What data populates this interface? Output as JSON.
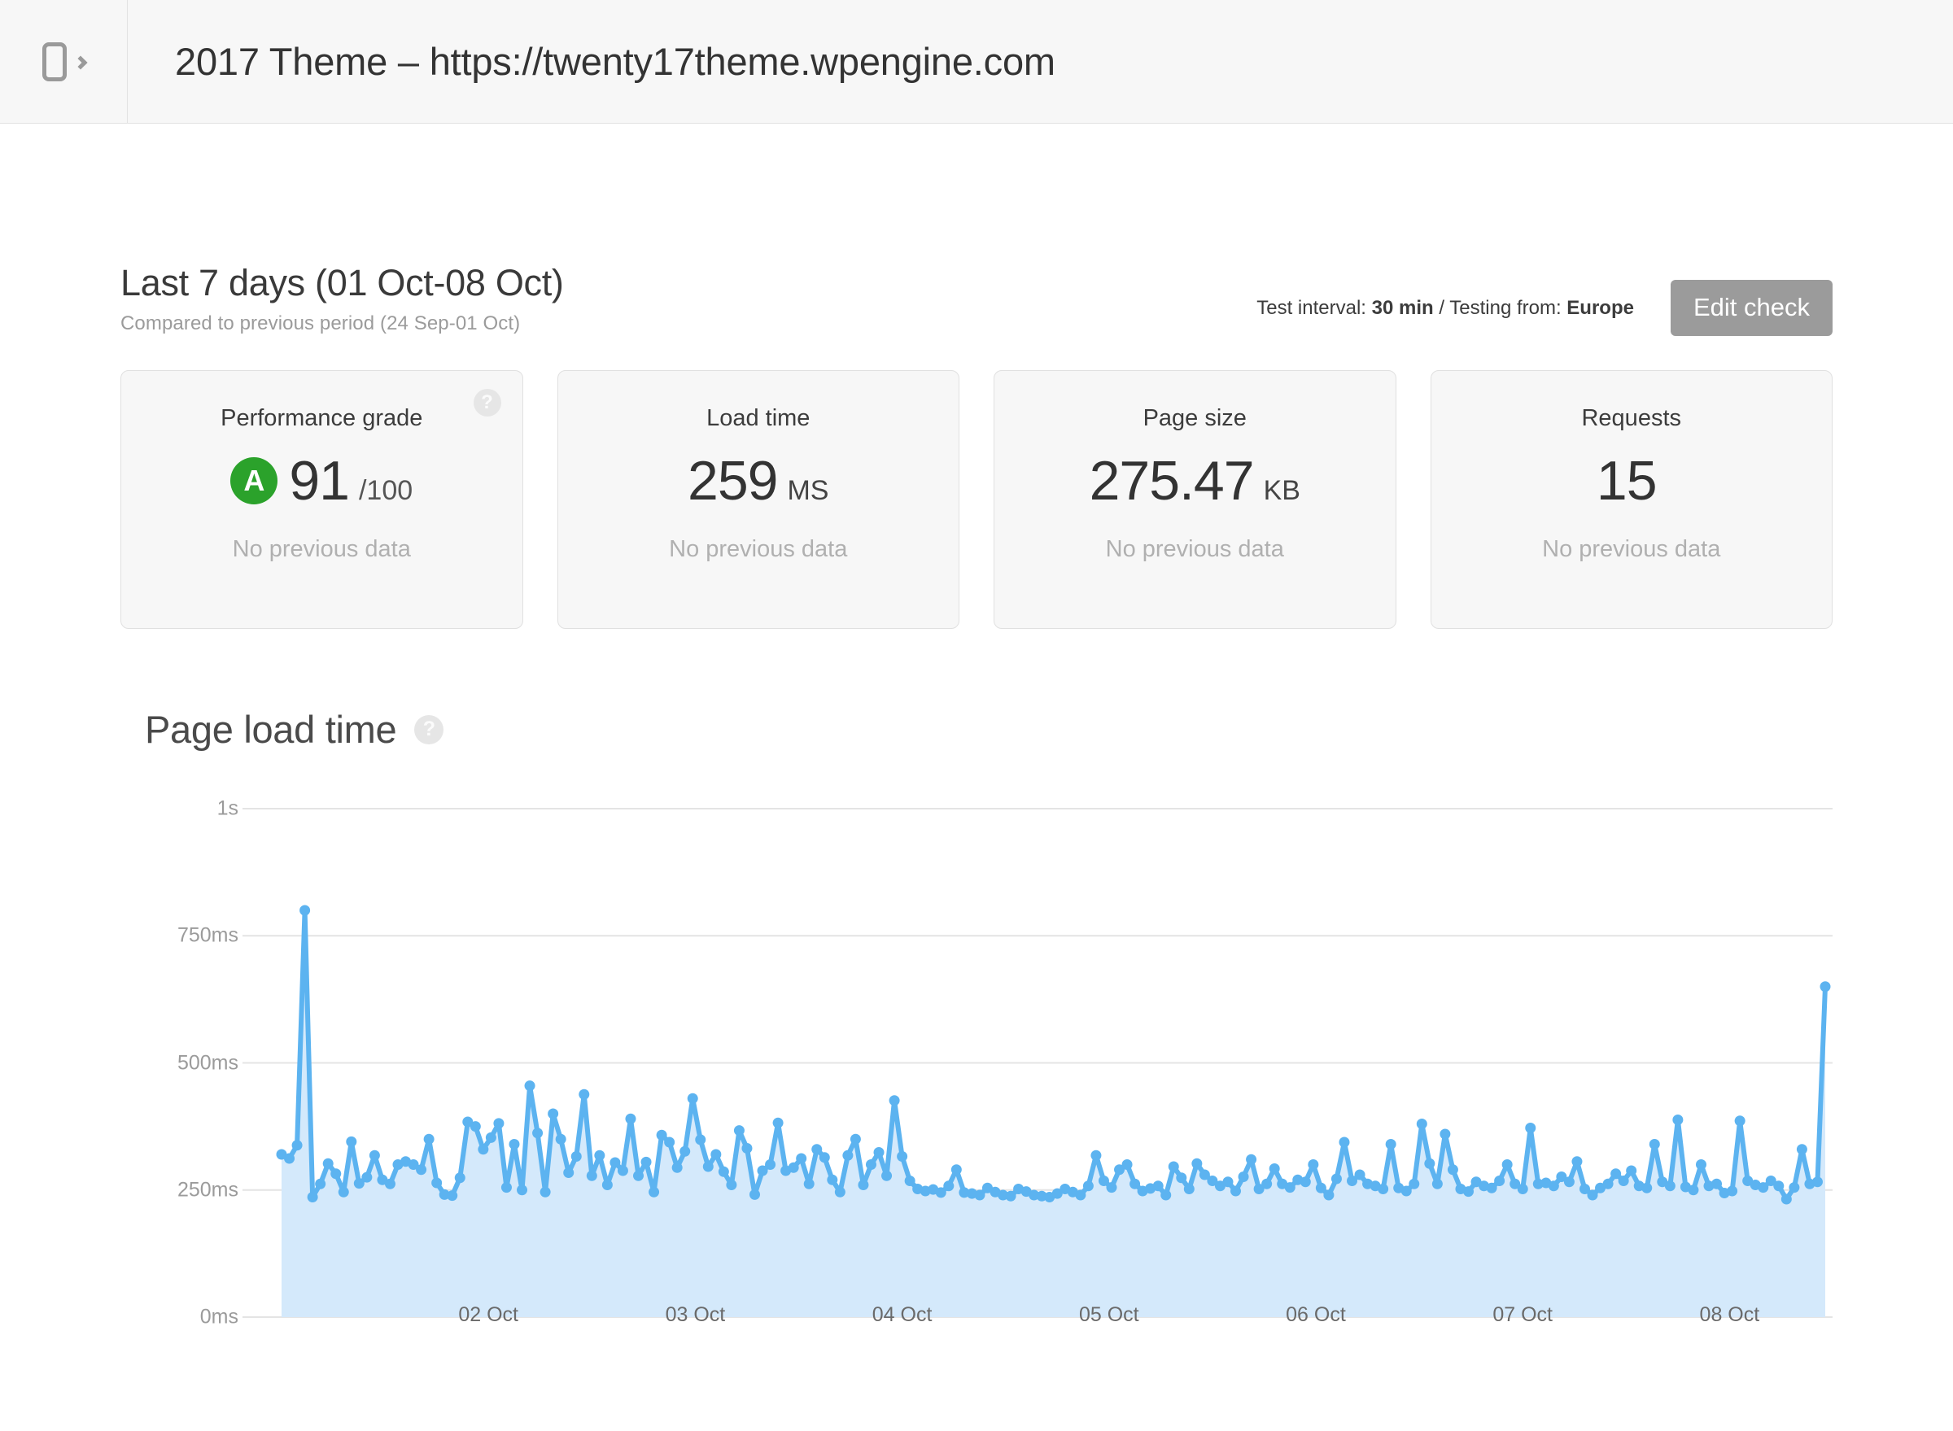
{
  "topbar": {
    "device_icon": "mobile-device-icon",
    "chevron_icon": "chevron-right-icon",
    "title": "2017 Theme – https://twenty17theme.wpengine.com"
  },
  "header": {
    "period_title": "Last 7 days (01 Oct-08 Oct)",
    "period_subtitle": "Compared to previous period (24 Sep-01 Oct)",
    "meta_interval_label": "Test interval: ",
    "meta_interval_value": "30 min",
    "meta_separator": " / ",
    "meta_location_label": "Testing from: ",
    "meta_location_value": "Europe",
    "edit_check_label": "Edit check"
  },
  "cards": [
    {
      "title": "Performance grade",
      "grade": "A",
      "value": "91",
      "unit": "/100",
      "note": "No previous data",
      "has_help": true,
      "grade_color": "#2ba22b"
    },
    {
      "title": "Load time",
      "grade": null,
      "value": "259",
      "unit": "MS",
      "note": "No previous data",
      "has_help": false
    },
    {
      "title": "Page size",
      "grade": null,
      "value": "275.47",
      "unit": "KB",
      "note": "No previous data",
      "has_help": false
    },
    {
      "title": "Requests",
      "grade": null,
      "value": "15",
      "unit": "",
      "note": "No previous data",
      "has_help": false
    }
  ],
  "chart_section": {
    "title": "Page load time",
    "help_icon": "question-mark-icon",
    "help_glyph": "?"
  },
  "chart_data": {
    "type": "area",
    "title": "Page load time",
    "xlabel": "",
    "ylabel": "",
    "ylim": [
      0,
      1000
    ],
    "grid": true,
    "legend": "none",
    "line_color": "#5cb3f0",
    "fill_color": "#d4e9fb",
    "grid_color": "#e4e4e4",
    "y_ticks": [
      {
        "value": 1000,
        "label": "1s"
      },
      {
        "value": 750,
        "label": "750ms"
      },
      {
        "value": 500,
        "label": "500ms"
      },
      {
        "value": 250,
        "label": "250ms"
      },
      {
        "value": 0,
        "label": "0ms"
      }
    ],
    "x_ticks": [
      {
        "pos": 0.134,
        "label": "02 Oct"
      },
      {
        "pos": 0.268,
        "label": "03 Oct"
      },
      {
        "pos": 0.402,
        "label": "04 Oct"
      },
      {
        "pos": 0.536,
        "label": "05 Oct"
      },
      {
        "pos": 0.67,
        "label": "06 Oct"
      },
      {
        "pos": 0.804,
        "label": "07 Oct"
      },
      {
        "pos": 0.938,
        "label": "08 Oct"
      }
    ],
    "unit": "ms",
    "series": [
      {
        "name": "Page load time",
        "values": [
          320,
          312,
          338,
          800,
          236,
          262,
          302,
          282,
          246,
          345,
          263,
          275,
          318,
          270,
          262,
          300,
          306,
          300,
          290,
          350,
          264,
          241,
          239,
          274,
          384,
          375,
          330,
          353,
          381,
          255,
          340,
          250,
          455,
          362,
          246,
          400,
          350,
          284,
          316,
          438,
          278,
          318,
          260,
          304,
          288,
          390,
          278,
          305,
          246,
          358,
          344,
          294,
          326,
          430,
          349,
          296,
          320,
          286,
          260,
          367,
          332,
          241,
          288,
          300,
          382,
          288,
          294,
          312,
          262,
          330,
          314,
          270,
          246,
          318,
          350,
          260,
          300,
          324,
          278,
          426,
          316,
          268,
          252,
          248,
          251,
          245,
          258,
          290,
          245,
          243,
          240,
          254,
          246,
          240,
          238,
          252,
          247,
          240,
          238,
          236,
          243,
          252,
          246,
          240,
          258,
          318,
          268,
          255,
          290,
          300,
          262,
          248,
          253,
          258,
          240,
          296,
          274,
          252,
          302,
          280,
          268,
          258,
          266,
          248,
          276,
          310,
          252,
          262,
          292,
          262,
          255,
          270,
          266,
          300,
          254,
          240,
          272,
          344,
          268,
          280,
          262,
          258,
          252,
          340,
          254,
          248,
          262,
          380,
          302,
          262,
          360,
          290,
          252,
          247,
          266,
          258,
          254,
          268,
          300,
          262,
          252,
          372,
          262,
          264,
          258,
          276,
          266,
          306,
          252,
          240,
          254,
          262,
          282,
          268,
          288,
          258,
          254,
          340,
          266,
          258,
          388,
          256,
          250,
          300,
          258,
          262,
          244,
          248,
          386,
          268,
          260,
          255,
          268,
          258,
          232,
          255,
          330,
          262,
          266,
          650
        ]
      }
    ]
  }
}
